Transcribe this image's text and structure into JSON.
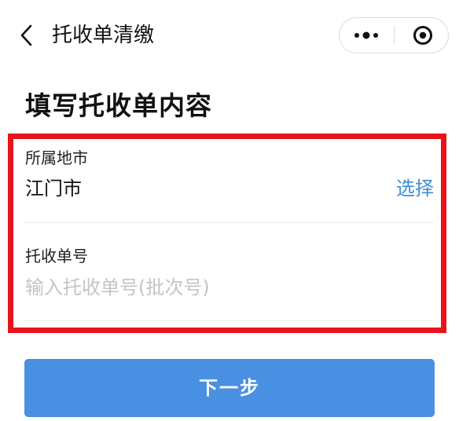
{
  "nav": {
    "title": "托收单清缴"
  },
  "page": {
    "heading": "填写托收单内容"
  },
  "form": {
    "city_field": {
      "label": "所属地市",
      "value": "江门市",
      "action_label": "选择"
    },
    "waybill_field": {
      "label": "托收单号",
      "placeholder": "输入托收单号(批次号)"
    },
    "highlight_color": "#e8131b"
  },
  "actions": {
    "next_label": "下一步"
  },
  "colors": {
    "link_blue": "#3b8fd8",
    "button_blue": "#4a90e2"
  },
  "icons": {
    "back": "chevron-left-icon",
    "more": "more-dots-icon",
    "close": "target-close-icon"
  }
}
